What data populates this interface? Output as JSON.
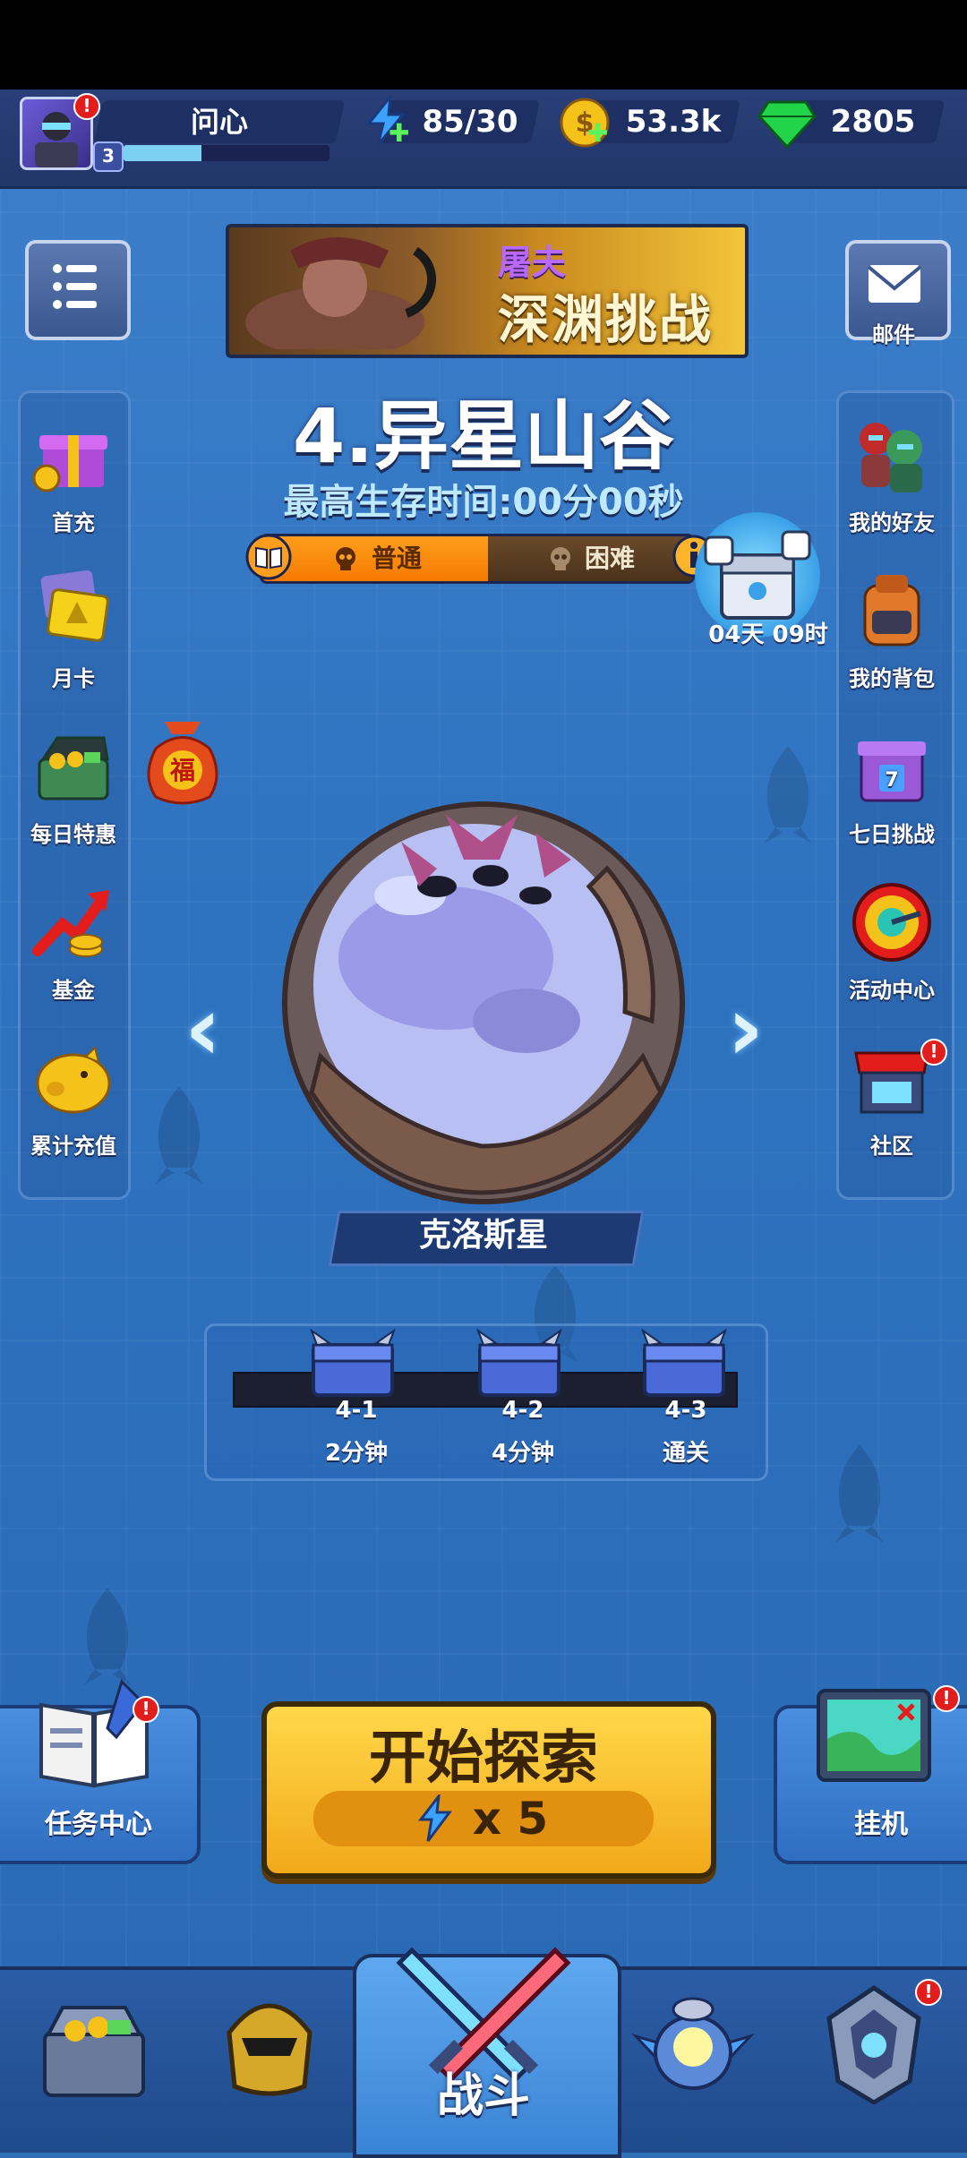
{
  "player": {
    "name": "问心",
    "level": "3",
    "xp_fraction": 0.38,
    "alert": "!"
  },
  "resources": {
    "energy": "85/30",
    "gold": "53.3k",
    "gems": "2805"
  },
  "banner": {
    "top": "屠夫",
    "main": "深渊挑战"
  },
  "mail_label": "邮件",
  "stage": {
    "title": "4.异星山谷",
    "survival": "最高生存时间:00分00秒",
    "difficulty_normal": "普通",
    "difficulty_hard": "困难"
  },
  "event_timer": "04天 09时",
  "left_menu": [
    "首充",
    "月卡",
    "每日特惠",
    "基金",
    "累计充值"
  ],
  "right_menu": [
    "我的好友",
    "我的背包",
    "七日挑战",
    "活动中心",
    "社区"
  ],
  "planet_name": "克洛斯星",
  "fortune_char": "福",
  "milestones": [
    {
      "id": "4-1",
      "label": "2分钟"
    },
    {
      "id": "4-2",
      "label": "4分钟"
    },
    {
      "id": "4-3",
      "label": "通关"
    }
  ],
  "start": {
    "title": "开始探索",
    "cost": "x 5"
  },
  "task_center": "任务中心",
  "idle": "挂机",
  "nav": {
    "battle": "战斗"
  },
  "colors": {
    "accent": "#f2a91a",
    "gem": "#22d44a",
    "gold": "#f5c21a",
    "energy": "#3ba3ff"
  }
}
